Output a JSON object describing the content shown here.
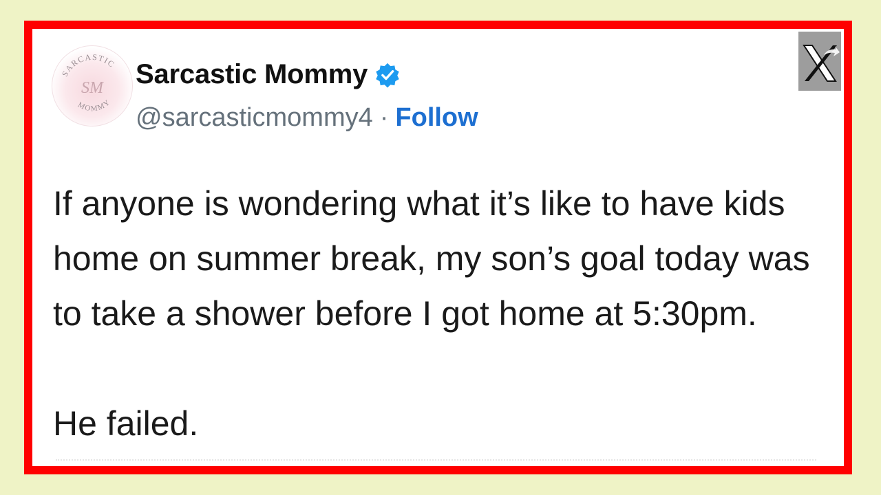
{
  "tweet": {
    "author_name": "Sarcastic Mommy",
    "handle": "@sarcasticmommy4",
    "separator": "·",
    "follow_label": "Follow",
    "avatar_text_top": "SARCASTIC",
    "avatar_monogram": "SM",
    "avatar_text_bottom": "MOMMY",
    "body_lines": [
      "If anyone is wondering what it’s like to have kids",
      "home on summer break, my son’s goal today was",
      "to take a shower before I got home at 5:30pm."
    ],
    "closing_line": "He failed."
  },
  "icons": {
    "verified": "verified-badge-icon",
    "platform": "x-logo-icon"
  },
  "colors": {
    "background": "#eff3c6",
    "frame_border": "#ff0000",
    "follow": "#1d6fd1",
    "verified": "#1d9bf0"
  }
}
